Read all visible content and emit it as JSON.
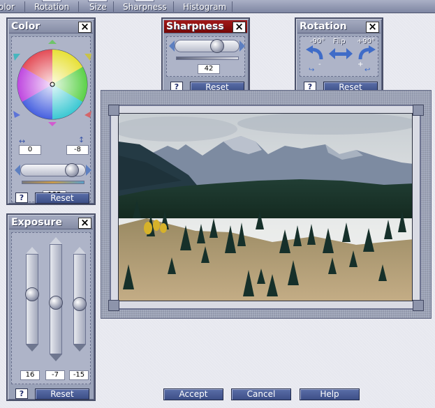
{
  "menu": {
    "items": [
      "olor",
      "Rotation",
      "Size",
      "Sharpness",
      "Histogram"
    ]
  },
  "color_panel": {
    "title": "Color",
    "close": "×",
    "value_h": "0",
    "value_v": "-8",
    "value_slider": "135",
    "help": "?",
    "reset": "Reset"
  },
  "sharpness_panel": {
    "title": "Sharpness",
    "close": "×",
    "value": "42",
    "help": "?",
    "reset": "Reset"
  },
  "rotation_panel": {
    "title": "Rotation",
    "close": "×",
    "label_ccw": "-90°",
    "label_flip": "Flip",
    "label_cw": "+90°",
    "minus": "-",
    "plus": "+",
    "help": "?",
    "reset": "Reset"
  },
  "exposure_panel": {
    "title": "Exposure",
    "close": "×",
    "values": [
      "16",
      "-7",
      "-15"
    ],
    "help": "?",
    "reset": "Reset"
  },
  "buttons": {
    "accept": "Accept",
    "cancel": "Cancel",
    "help": "Help"
  },
  "colors": {
    "active_title": "#8b0c0c",
    "panel": "#9aa2b8",
    "button": "#4a5c96"
  },
  "icons": [
    "close-icon",
    "help-icon",
    "rotate-ccw-icon",
    "flip-icon",
    "rotate-cw-icon",
    "color-wheel-icon"
  ]
}
